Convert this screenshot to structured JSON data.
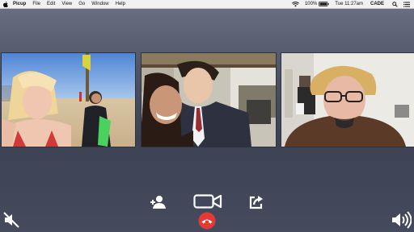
{
  "menubar": {
    "app_name": "Picup",
    "items": [
      "File",
      "Edit",
      "View",
      "Go",
      "Window",
      "Help"
    ],
    "battery_percent": "100%",
    "clock": "Tue 11:27am",
    "user": "CADE"
  },
  "call": {
    "participants": 3,
    "controls": [
      "add-person-icon",
      "video-camera-icon",
      "share-icon",
      "hang-up-icon",
      "muted-microphone-icon",
      "speaker-icon"
    ],
    "end_call_color": "#e53935",
    "icon_color": "#ffffff"
  }
}
